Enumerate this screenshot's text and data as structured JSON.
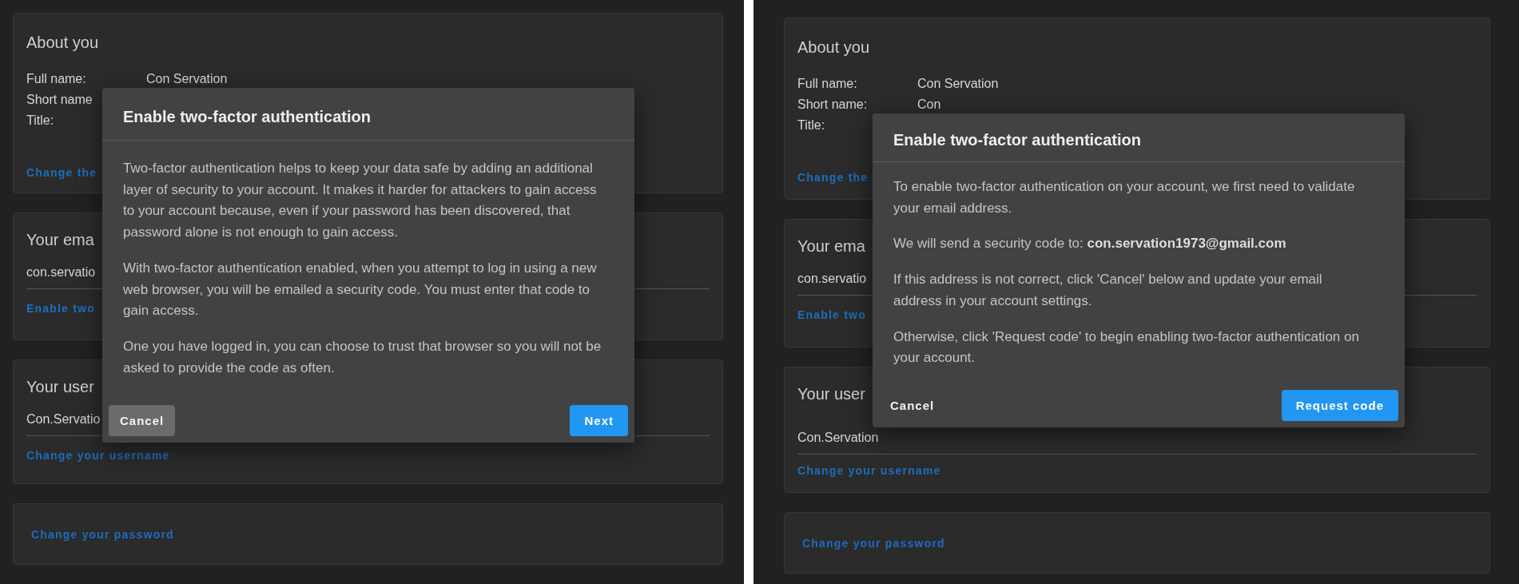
{
  "panels": [
    {
      "about": {
        "title": "About you",
        "fields": [
          {
            "label": "Full name:",
            "value": "Con Servation"
          },
          {
            "label": "Short name"
          },
          {
            "label": "Title:"
          }
        ],
        "link": "Change the"
      },
      "email": {
        "title": "Your ema",
        "value": "con.servatio",
        "link": "Enable two"
      },
      "username": {
        "title": "Your user",
        "value": "Con.Servatio",
        "link": "Change your username"
      },
      "password": {
        "link": "Change your password"
      },
      "dialog": {
        "title": "Enable two-factor authentication",
        "paragraphs": [
          "Two-factor authentication helps to keep your data safe by adding an additional layer of security to your account. It makes it harder for attackers to gain access to your account because, even if your password has been discovered, that password alone is not enough to gain access.",
          "With two-factor authentication enabled, when you attempt to log in using a new web browser, you will be emailed a security code. You must enter that code to gain access.",
          "One you have logged in, you can choose to trust that browser so you will not be asked to provide the code as often."
        ],
        "buttons": [
          {
            "label": "Cancel",
            "kind": "text",
            "highlighted": true
          },
          {
            "label": "Next",
            "kind": "primary"
          }
        ]
      }
    },
    {
      "about": {
        "title": "About you",
        "fields": [
          {
            "label": "Full name:",
            "value": "Con Servation"
          },
          {
            "label": "Short name:",
            "value": "Con"
          },
          {
            "label": "Title:"
          }
        ],
        "link": "Change the"
      },
      "email": {
        "title": "Your ema",
        "value": "con.servatio",
        "link": "Enable two"
      },
      "username": {
        "title": "Your user",
        "value": "Con.Servation",
        "link": "Change your username"
      },
      "password": {
        "link": "Change your password"
      },
      "dialog": {
        "title": "Enable two-factor authentication",
        "paragraphs": [
          "To enable two-factor authentication on your account, we first need to validate your email address.",
          "We will send a security code to: **con.servation1973@gmail.com**",
          "If this address is not correct, click 'Cancel' below and update your email address in your account settings.",
          "Otherwise, click 'Request code' to begin enabling two-factor authentication on your account."
        ],
        "buttons": [
          {
            "label": "Cancel",
            "kind": "text",
            "highlighted": false
          },
          {
            "label": "Request code",
            "kind": "primary"
          }
        ]
      }
    }
  ]
}
